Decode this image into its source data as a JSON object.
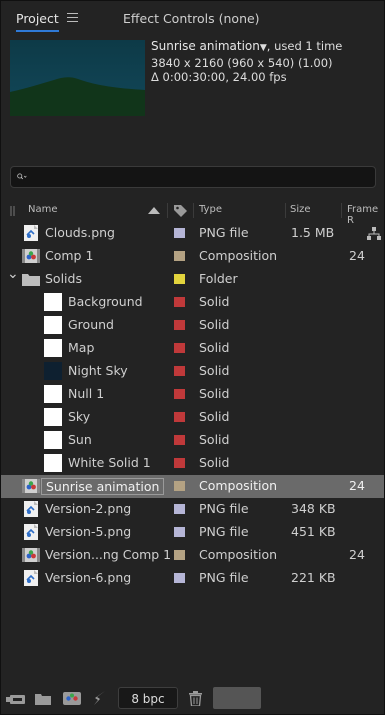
{
  "tabs": {
    "project": "Project",
    "effect_controls": "Effect Controls (none)"
  },
  "info": {
    "title": "Sunrise animation",
    "used": ", used 1 time",
    "resolution": "3840 x 2160  (960 x 540) (1.00)",
    "duration": "Δ 0:00:30:00, 24.00 fps"
  },
  "search": {
    "placeholder": ""
  },
  "columns": {
    "name": "Name",
    "type": "Type",
    "size": "Size",
    "frame_rate": "Frame R"
  },
  "rows": [
    {
      "name": "Clouds.png",
      "type": "PNG file",
      "size": "1.5 MB",
      "fps": "",
      "label": "#b5b5d6",
      "icon": "png"
    },
    {
      "name": "Comp 1",
      "type": "Composition",
      "size": "",
      "fps": "24",
      "label": "#b4a283",
      "icon": "comp"
    },
    {
      "name": "Solids",
      "type": "Folder",
      "size": "",
      "fps": "",
      "label": "#e3d43d",
      "icon": "folder"
    },
    {
      "name": "Background",
      "type": "Solid",
      "size": "",
      "fps": "",
      "label": "#c0393a",
      "icon": "solid-white"
    },
    {
      "name": "Ground",
      "type": "Solid",
      "size": "",
      "fps": "",
      "label": "#c0393a",
      "icon": "solid-white"
    },
    {
      "name": "Map",
      "type": "Solid",
      "size": "",
      "fps": "",
      "label": "#c0393a",
      "icon": "solid-white"
    },
    {
      "name": "Night Sky",
      "type": "Solid",
      "size": "",
      "fps": "",
      "label": "#c0393a",
      "icon": "solid-navy"
    },
    {
      "name": "Null 1",
      "type": "Solid",
      "size": "",
      "fps": "",
      "label": "#c0393a",
      "icon": "solid-white"
    },
    {
      "name": "Sky",
      "type": "Solid",
      "size": "",
      "fps": "",
      "label": "#c0393a",
      "icon": "solid-white"
    },
    {
      "name": "Sun",
      "type": "Solid",
      "size": "",
      "fps": "",
      "label": "#c0393a",
      "icon": "solid-white"
    },
    {
      "name": "White Solid 1",
      "type": "Solid",
      "size": "",
      "fps": "",
      "label": "#c0393a",
      "icon": "solid-white"
    },
    {
      "name": "Sunrise animation",
      "type": "Composition",
      "size": "",
      "fps": "24",
      "label": "#b4a283",
      "icon": "comp"
    },
    {
      "name": "Version-2.png",
      "type": "PNG file",
      "size": "348 KB",
      "fps": "",
      "label": "#b5b5d6",
      "icon": "png"
    },
    {
      "name": "Version-5.png",
      "type": "PNG file",
      "size": "451 KB",
      "fps": "",
      "label": "#b5b5d6",
      "icon": "png"
    },
    {
      "name": "Version...ng Comp 1",
      "type": "Composition",
      "size": "",
      "fps": "24",
      "label": "#b4a283",
      "icon": "comp"
    },
    {
      "name": "Version-6.png",
      "type": "PNG file",
      "size": "221 KB",
      "fps": "",
      "label": "#b5b5d6",
      "icon": "png"
    }
  ],
  "bottom": {
    "bpc": "8 bpc"
  }
}
